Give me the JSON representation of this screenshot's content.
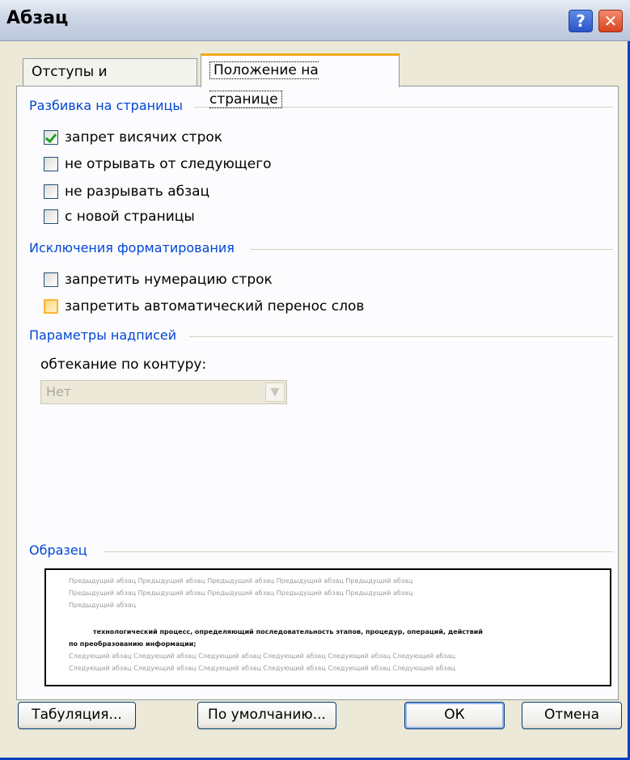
{
  "window": {
    "title": "Абзац",
    "help_icon": "?",
    "close_icon": "✕"
  },
  "tabs": [
    {
      "label": "Отступы и интервалы",
      "active": false
    },
    {
      "label": "Положение на странице",
      "active": true
    }
  ],
  "pagination": {
    "heading": "Разбивка на страницы",
    "options": [
      {
        "label": "запрет висячих строк",
        "checked": true
      },
      {
        "label": "не отрывать от следующего",
        "checked": false
      },
      {
        "label": "не разрывать абзац",
        "checked": false
      },
      {
        "label": "с новой страницы",
        "checked": false
      }
    ]
  },
  "formatting_exceptions": {
    "heading": "Исключения форматирования",
    "options": [
      {
        "label": "запретить нумерацию строк",
        "checked": false
      },
      {
        "label": "запретить автоматический перенос слов",
        "checked": false
      }
    ]
  },
  "textbox_options": {
    "heading": "Параметры надписей",
    "wrap_label": "обтекание по контуру:",
    "wrap_value": "Нет"
  },
  "preview": {
    "heading": "Образец",
    "prev_lines": [
      "Предыдущий абзац Предыдущий абзац Предыдущий абзац Предыдущий абзац Предыдущий абзац",
      "Предыдущий абзац Предыдущий абзац Предыдущий абзац Предыдущий абзац Предыдущий абзац",
      "Предыдущий абзац"
    ],
    "main_lines": [
      "технологический процесс, определяющий последовательность этапов, процедур, операций, действий",
      "по преобразованию информации;"
    ],
    "next_lines": [
      "Следующий абзац Следующий абзац Следующий абзац Следующий абзац Следующий абзац Следующий абзац",
      "Следующий абзац Следующий абзац Следующий абзац Следующий абзац Следующий абзац Следующий абзац"
    ]
  },
  "buttons": {
    "tabs": "Табуляция...",
    "default": "По умолчанию...",
    "ok": "ОК",
    "cancel": "Отмена"
  }
}
